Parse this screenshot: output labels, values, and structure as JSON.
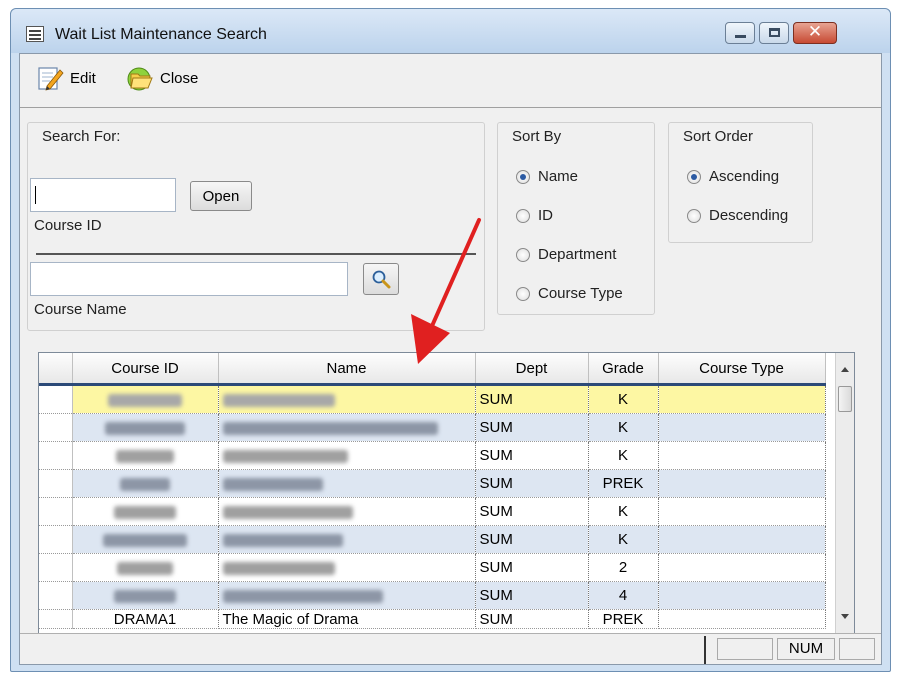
{
  "window": {
    "title": "Wait List Maintenance Search"
  },
  "toolbar": {
    "edit_label": "Edit",
    "close_label": "Close"
  },
  "search": {
    "title": "Search For:",
    "course_id_value": "",
    "open_label": "Open",
    "course_id_label": "Course ID",
    "course_name_value": "",
    "course_name_label": "Course Name"
  },
  "sort_by": {
    "title": "Sort By",
    "options": [
      {
        "label": "Name",
        "selected": true
      },
      {
        "label": "ID",
        "selected": false
      },
      {
        "label": "Department",
        "selected": false
      },
      {
        "label": "Course Type",
        "selected": false
      }
    ]
  },
  "sort_order": {
    "title": "Sort Order",
    "options": [
      {
        "label": "Ascending",
        "selected": true
      },
      {
        "label": "Descending",
        "selected": false
      }
    ]
  },
  "grid": {
    "columns": [
      "Course ID",
      "Name",
      "Dept",
      "Grade",
      "Course Type"
    ],
    "rows": [
      {
        "dept": "SUM",
        "grade": "K",
        "course_type": ""
      },
      {
        "dept": "SUM",
        "grade": "K",
        "course_type": ""
      },
      {
        "dept": "SUM",
        "grade": "K",
        "course_type": ""
      },
      {
        "dept": "SUM",
        "grade": "PREK",
        "course_type": ""
      },
      {
        "dept": "SUM",
        "grade": "K",
        "course_type": ""
      },
      {
        "dept": "SUM",
        "grade": "K",
        "course_type": ""
      },
      {
        "dept": "SUM",
        "grade": "2",
        "course_type": ""
      },
      {
        "dept": "SUM",
        "grade": "4",
        "course_type": ""
      }
    ],
    "last_row": {
      "course_id": "DRAMA1",
      "name": "The Magic of Drama",
      "dept": "SUM",
      "grade": "PREK",
      "course_type": ""
    }
  },
  "status": {
    "num": "NUM"
  },
  "colors": {
    "selected_row": "#fdf7a3",
    "alt_row": "#dde6f2",
    "arrow": "#e02020"
  }
}
